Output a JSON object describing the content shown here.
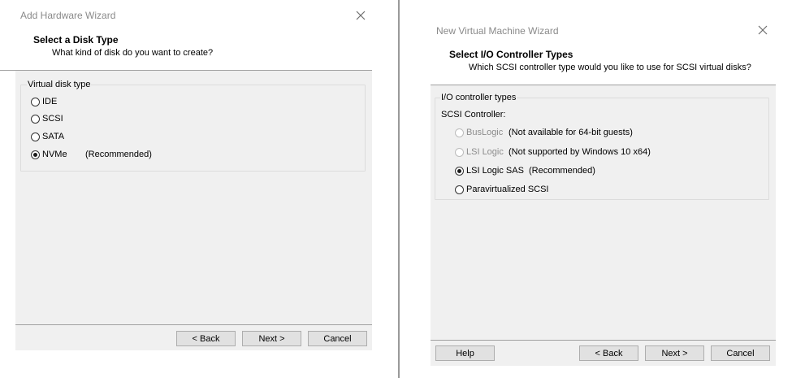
{
  "left_dialog": {
    "window_title": "Add Hardware Wizard",
    "header_title": "Select a Disk Type",
    "header_subtitle": "What kind of disk do you want to create?",
    "group_label": "Virtual disk type",
    "options": [
      {
        "label": "IDE",
        "note": "",
        "checked": false,
        "enabled": true
      },
      {
        "label": "SCSI",
        "note": "",
        "checked": false,
        "enabled": true
      },
      {
        "label": "SATA",
        "note": "",
        "checked": false,
        "enabled": true
      },
      {
        "label": "NVMe",
        "note": "(Recommended)",
        "checked": true,
        "enabled": true
      }
    ],
    "buttons": {
      "back": "< Back",
      "next": "Next >",
      "cancel": "Cancel"
    }
  },
  "right_dialog": {
    "window_title": "New Virtual Machine Wizard",
    "header_title": "Select I/O Controller Types",
    "header_subtitle": "Which SCSI controller type would you like to use for SCSI virtual disks?",
    "group_label": "I/O controller types",
    "section_label": "SCSI Controller:",
    "options": [
      {
        "label": "BusLogic",
        "note": "(Not available for 64-bit guests)",
        "checked": false,
        "enabled": false
      },
      {
        "label": "LSI Logic",
        "note": "(Not supported by Windows 10 x64)",
        "checked": false,
        "enabled": false
      },
      {
        "label": "LSI Logic SAS",
        "note": "(Recommended)",
        "checked": true,
        "enabled": true
      },
      {
        "label": "Paravirtualized SCSI",
        "note": "",
        "checked": false,
        "enabled": true
      }
    ],
    "buttons": {
      "help": "Help",
      "back": "< Back",
      "next": "Next >",
      "cancel": "Cancel"
    }
  }
}
